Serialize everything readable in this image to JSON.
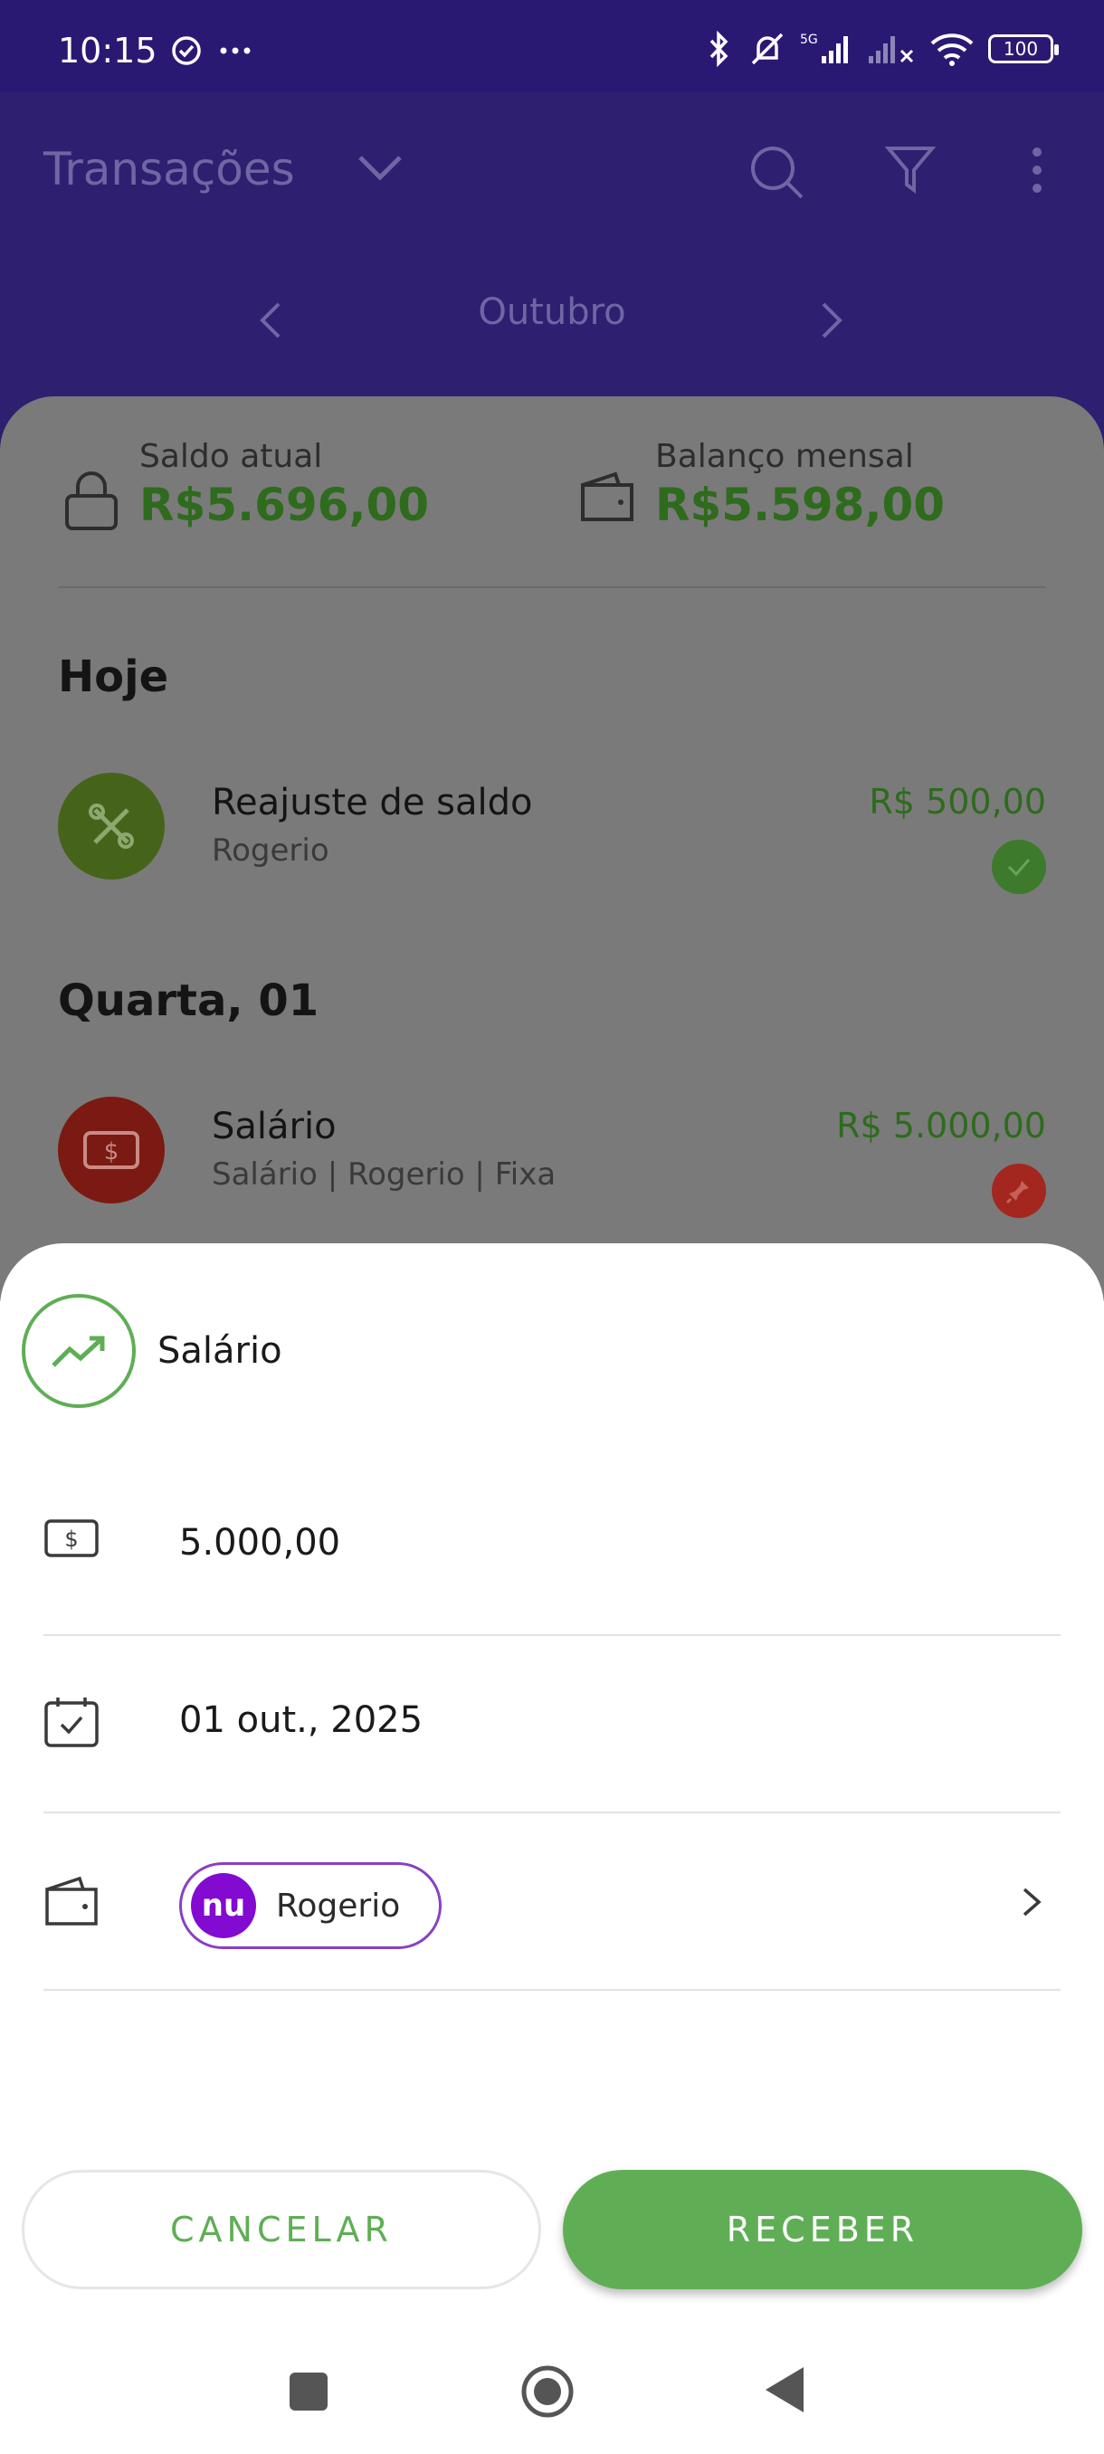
{
  "status_bar": {
    "time": "10:15",
    "battery": "100"
  },
  "header": {
    "title": "Transações",
    "month": "Outubro"
  },
  "summary": {
    "current_balance_label": "Saldo atual",
    "current_balance_value": "R$5.696,00",
    "monthly_balance_label": "Balanço mensal",
    "monthly_balance_value": "R$5.598,00"
  },
  "sections": [
    {
      "title": "Hoje",
      "transactions": [
        {
          "name": "Reajuste de saldo",
          "sub": "Rogerio",
          "amount": "R$ 500,00",
          "status": "confirmed"
        }
      ]
    },
    {
      "title": "Quarta, 01",
      "transactions": [
        {
          "name": "Salário",
          "sub": "Salário | Rogerio  | Fixa",
          "amount": "R$ 5.000,00",
          "status": "pinned"
        }
      ]
    }
  ],
  "sheet": {
    "title": "Salário",
    "amount": "5.000,00",
    "date": "01 out., 2025",
    "account": "Rogerio",
    "account_logo": "nu",
    "cancel_label": "CANCELAR",
    "receive_label": "RECEBER"
  },
  "colors": {
    "header_purple": "#2f1f70",
    "income_green": "#5fae55",
    "expense_red": "#7a1a12",
    "nubank_purple": "#820ad1"
  }
}
